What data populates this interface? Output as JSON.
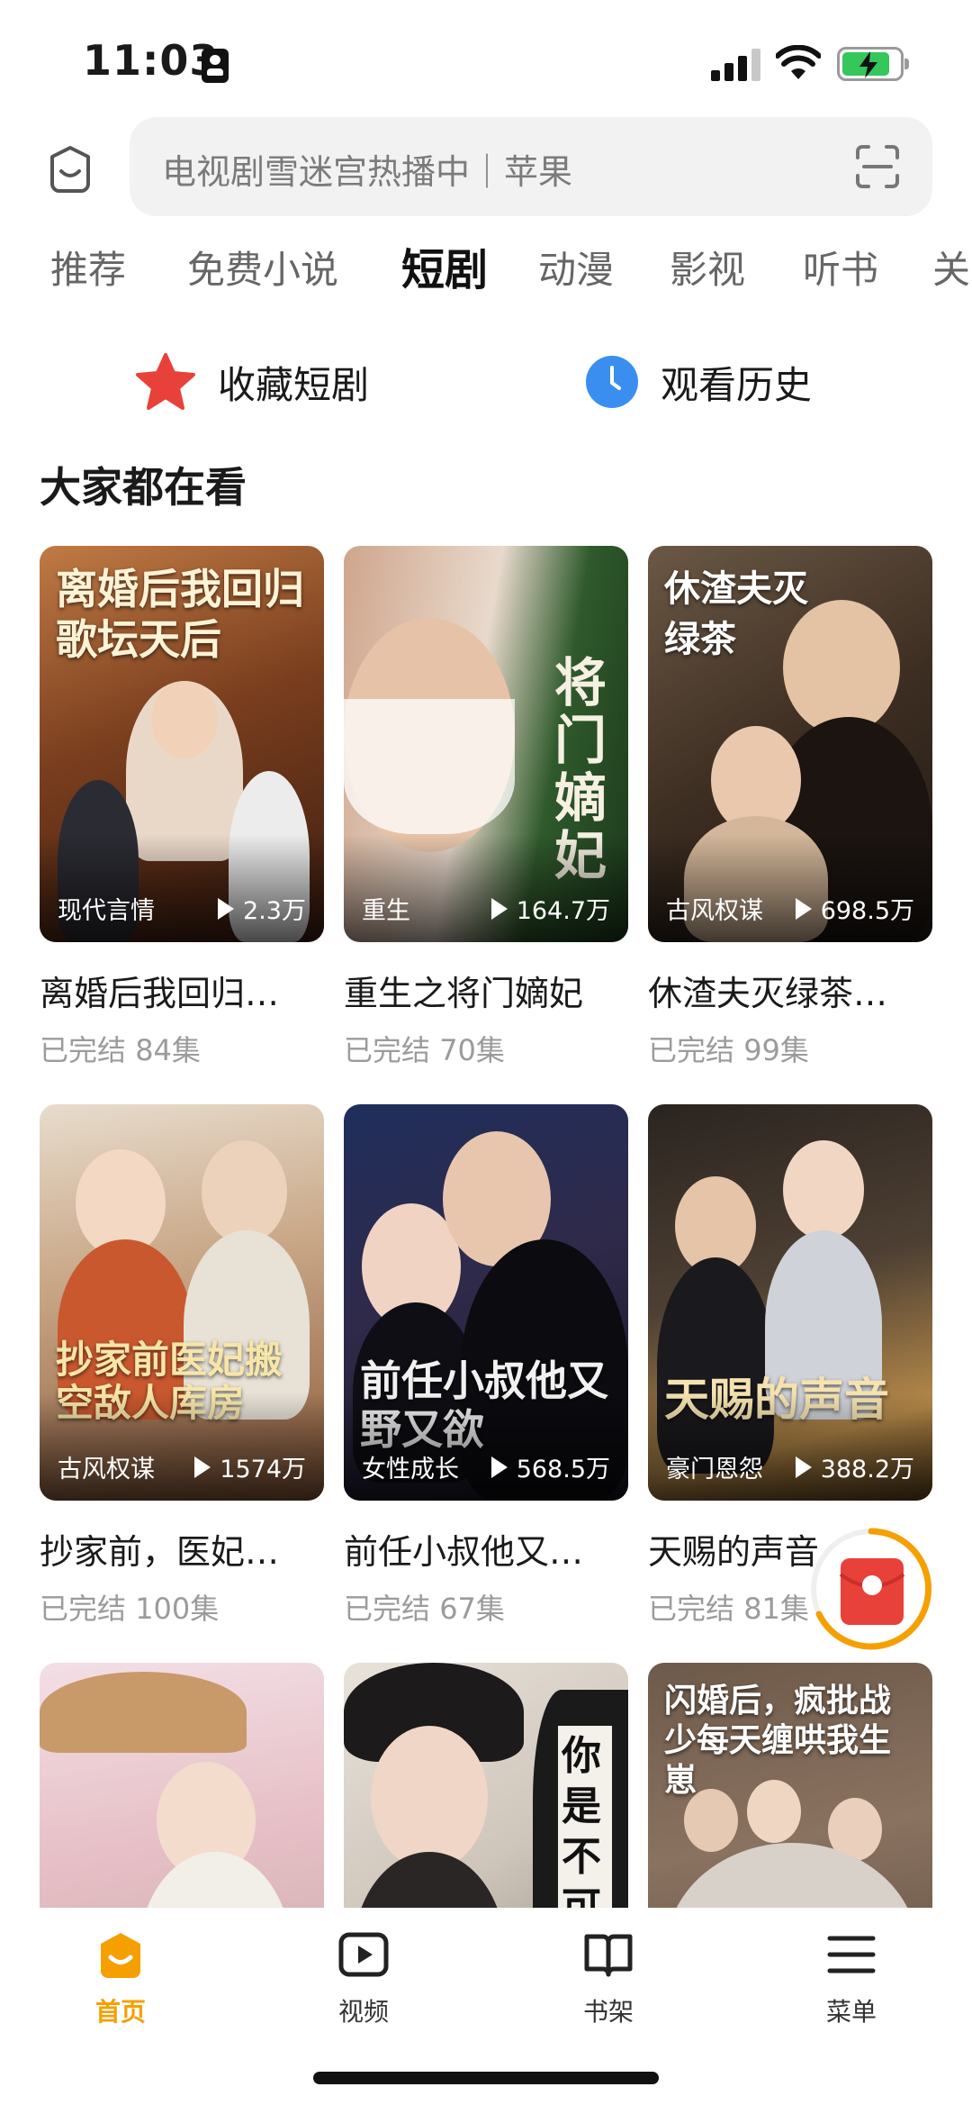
{
  "status_bar": {
    "time": "11:03"
  },
  "search": {
    "placeholder": "电视剧雪迷宫热播中｜苹果"
  },
  "tabs": [
    {
      "label": "推荐"
    },
    {
      "label": "免费小说"
    },
    {
      "label": "短剧"
    },
    {
      "label": "动漫"
    },
    {
      "label": "影视"
    },
    {
      "label": "听书"
    },
    {
      "label": "关"
    }
  ],
  "shortcuts": {
    "favorites": "收藏短剧",
    "history": "观看历史"
  },
  "section": {
    "title": "大家都在看"
  },
  "dramas": [
    {
      "cover_title": "离婚后我回归歌坛天后",
      "tag": "现代言情",
      "views": "2.3万",
      "name": "离婚后我回归…",
      "status": "已完结",
      "episodes": "84集"
    },
    {
      "cover_title": "将门嫡妃",
      "tag": "重生",
      "views": "164.7万",
      "name": "重生之将门嫡妃",
      "status": "已完结",
      "episodes": "70集"
    },
    {
      "cover_title": "休渣夫灭绿茶",
      "tag": "古风权谋",
      "views": "698.5万",
      "name": "休渣夫灭绿茶…",
      "status": "已完结",
      "episodes": "99集"
    },
    {
      "cover_title": "抄家前医妃搬空敌人库房",
      "tag": "古风权谋",
      "views": "1574万",
      "name": "抄家前，医妃…",
      "status": "已完结",
      "episodes": "100集"
    },
    {
      "cover_title": "前任小叔他又野又欲",
      "tag": "女性成长",
      "views": "568.5万",
      "name": "前任小叔他又…",
      "status": "已完结",
      "episodes": "67集"
    },
    {
      "cover_title": "天赐的声音",
      "tag": "豪门恩怨",
      "views": "388.2万",
      "name": "天赐的声音",
      "status": "已完结",
      "episodes": "81集"
    },
    {
      "cover_title": "",
      "tag": "",
      "views": "",
      "name": "",
      "status": "",
      "episodes": ""
    },
    {
      "cover_title": "你是不可",
      "tag": "",
      "views": "",
      "name": "",
      "status": "",
      "episodes": ""
    },
    {
      "cover_title": "闪婚后，疯批战少每天缠哄我生崽",
      "tag": "",
      "views": "",
      "name": "",
      "status": "",
      "episodes": ""
    }
  ],
  "bottom_nav": [
    {
      "label": "首页",
      "icon": "home-icon",
      "active": true
    },
    {
      "label": "视频",
      "icon": "video-icon",
      "active": false
    },
    {
      "label": "书架",
      "icon": "bookshelf-icon",
      "active": false
    },
    {
      "label": "菜单",
      "icon": "menu-icon",
      "active": false
    }
  ],
  "colors": {
    "accent": "#f5a000",
    "red": "#e8413a",
    "history_blue": "#3a8ef0"
  }
}
